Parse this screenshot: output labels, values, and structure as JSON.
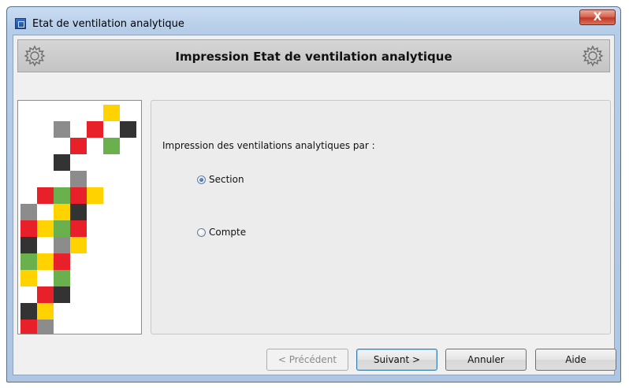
{
  "window": {
    "title": "Etat de ventilation analytique",
    "close_label": "X"
  },
  "header": {
    "title": "Impression Etat de ventilation analytique"
  },
  "content": {
    "prompt": "Impression des ventilations analytiques par :",
    "options": [
      {
        "label": "Section",
        "selected": true
      },
      {
        "label": "Compte",
        "selected": false
      }
    ]
  },
  "buttons": {
    "previous": "< Précédent",
    "next": "Suivant >",
    "cancel": "Annuler",
    "help": "Aide"
  },
  "colors": {
    "red": "#e8202a",
    "yellow": "#ffd200",
    "green": "#6ab04c",
    "dark": "#333333",
    "gray": "#8c8c8c"
  }
}
